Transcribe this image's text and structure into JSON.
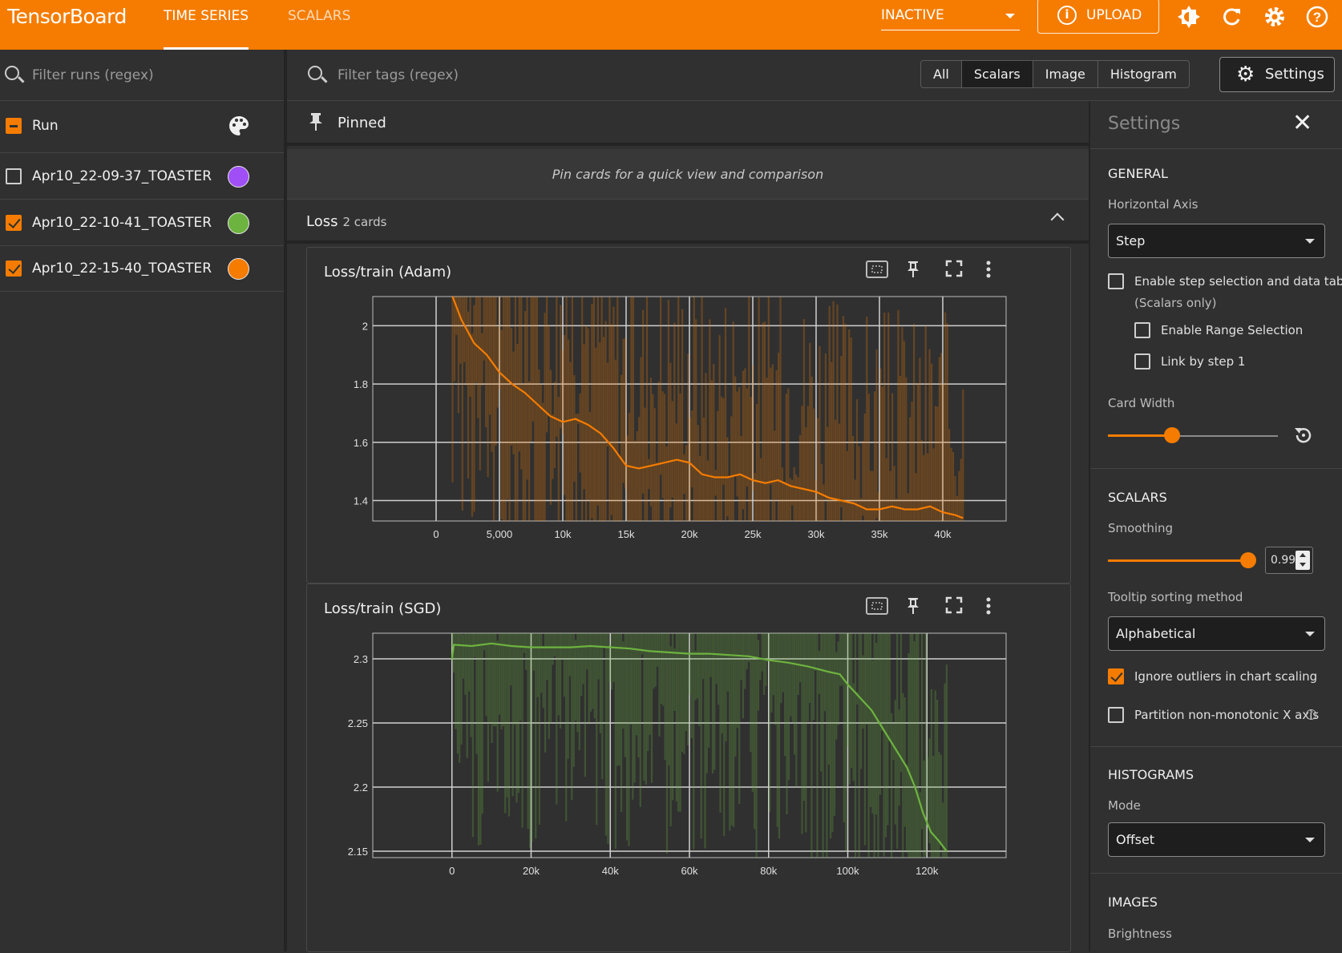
{
  "app": {
    "brand": "TensorBoard"
  },
  "topbar": {
    "tabs": [
      {
        "label": "TIME SERIES",
        "active": true
      },
      {
        "label": "SCALARS",
        "active": false
      }
    ],
    "reload_status": "INACTIVE",
    "upload_label": "UPLOAD",
    "icons": [
      "theme-icon",
      "reload-icon",
      "settings-gear-icon",
      "help-icon"
    ],
    "accent": "#f57c00"
  },
  "runs": {
    "filter_placeholder": "Filter runs (regex)",
    "header_label": "Run",
    "items": [
      {
        "name": "Apr10_22-09-37_TOASTER",
        "checked": false,
        "color": "#9f4ff5"
      },
      {
        "name": "Apr10_22-10-41_TOASTER",
        "checked": true,
        "color": "#6db33f"
      },
      {
        "name": "Apr10_22-15-40_TOASTER",
        "checked": true,
        "color": "#f57c00"
      }
    ]
  },
  "tags": {
    "filter_placeholder": "Filter tags (regex)",
    "type_filters": [
      "All",
      "Scalars",
      "Image",
      "Histogram"
    ],
    "type_filter_selected": "Scalars",
    "settings_button": "Settings"
  },
  "pinned": {
    "title": "Pinned",
    "empty_text": "Pin cards for a quick view and comparison"
  },
  "group": {
    "name": "Loss",
    "count_text": "2 cards"
  },
  "cards": [
    {
      "title": "Loss/train (Adam)"
    },
    {
      "title": "Loss/train (SGD)"
    }
  ],
  "chart_data": [
    {
      "type": "line",
      "title": "Loss/train (Adam)",
      "xlabel": "",
      "ylabel": "",
      "x_ticks": [
        "0",
        "5,000",
        "10k",
        "15k",
        "20k",
        "25k",
        "30k",
        "35k",
        "40k"
      ],
      "y_ticks": [
        "1.4",
        "1.6",
        "1.8",
        "2"
      ],
      "xlim": [
        -5000,
        45000
      ],
      "ylim": [
        1.33,
        2.1
      ],
      "grid": true,
      "series": [
        {
          "color": "#f57c00",
          "smoothed": true,
          "x": [
            1300,
            2000,
            3000,
            4000,
            5000,
            6000,
            7000,
            8000,
            9000,
            10000,
            11000,
            12000,
            13000,
            14000,
            15000,
            16000,
            17000,
            18000,
            19000,
            20000,
            21000,
            22000,
            23000,
            24000,
            25000,
            26000,
            27000,
            28000,
            29000,
            30000,
            31000,
            32000,
            33000,
            34000,
            35000,
            36000,
            37000,
            38000,
            39000,
            40000,
            41000,
            41600
          ],
          "y": [
            2.1,
            2.02,
            1.94,
            1.9,
            1.84,
            1.8,
            1.77,
            1.73,
            1.69,
            1.67,
            1.68,
            1.66,
            1.63,
            1.58,
            1.52,
            1.51,
            1.52,
            1.53,
            1.54,
            1.53,
            1.49,
            1.48,
            1.48,
            1.49,
            1.47,
            1.46,
            1.47,
            1.45,
            1.44,
            1.43,
            1.41,
            1.4,
            1.39,
            1.37,
            1.37,
            1.38,
            1.37,
            1.37,
            1.38,
            1.36,
            1.35,
            1.34
          ]
        }
      ]
    },
    {
      "type": "line",
      "title": "Loss/train (SGD)",
      "xlabel": "",
      "ylabel": "",
      "x_ticks": [
        "0",
        "20k",
        "40k",
        "60k",
        "80k",
        "100k",
        "120k"
      ],
      "y_ticks": [
        "2.15",
        "2.2",
        "2.25",
        "2.3"
      ],
      "xlim": [
        -20000,
        140000
      ],
      "ylim": [
        2.145,
        2.32
      ],
      "grid": true,
      "series": [
        {
          "color": "#6db33f",
          "smoothed": true,
          "x": [
            0,
            500,
            5000,
            10000,
            15000,
            20000,
            25000,
            30000,
            35000,
            40000,
            45000,
            50000,
            55000,
            60000,
            65000,
            70000,
            75000,
            80000,
            85000,
            90000,
            95000,
            98000,
            100000,
            103000,
            106000,
            109000,
            112000,
            115000,
            117000,
            119000,
            121000,
            123000,
            125000
          ],
          "y": [
            2.3,
            2.311,
            2.31,
            2.312,
            2.31,
            2.309,
            2.309,
            2.309,
            2.31,
            2.309,
            2.308,
            2.306,
            2.305,
            2.304,
            2.304,
            2.303,
            2.302,
            2.299,
            2.297,
            2.294,
            2.29,
            2.288,
            2.28,
            2.27,
            2.26,
            2.245,
            2.23,
            2.215,
            2.2,
            2.18,
            2.165,
            2.158,
            2.15
          ]
        }
      ]
    }
  ],
  "settings": {
    "title": "Settings",
    "general": {
      "heading": "GENERAL",
      "horizontal_axis_label": "Horizontal Axis",
      "horizontal_axis_value": "Step",
      "step_selection_label": "Enable step selection and data table",
      "step_selection_sub": "(Scalars only)",
      "step_selection_checked": false,
      "range_selection_label": "Enable Range Selection",
      "range_selection_checked": false,
      "link_by_step_label": "Link by step 1",
      "link_by_step_checked": false,
      "card_width_label": "Card Width",
      "card_width_level": 0.37
    },
    "scalars": {
      "heading": "SCALARS",
      "smoothing_label": "Smoothing",
      "smoothing_value": "0.99",
      "tooltip_sort_label": "Tooltip sorting method",
      "tooltip_sort_value": "Alphabetical",
      "ignore_outliers_label": "Ignore outliers in chart scaling",
      "ignore_outliers_checked": true,
      "partition_label": "Partition non-monotonic X axis",
      "partition_checked": false
    },
    "histograms": {
      "heading": "HISTOGRAMS",
      "mode_label": "Mode",
      "mode_value": "Offset"
    },
    "images": {
      "heading": "IMAGES",
      "brightness_label": "Brightness"
    }
  }
}
